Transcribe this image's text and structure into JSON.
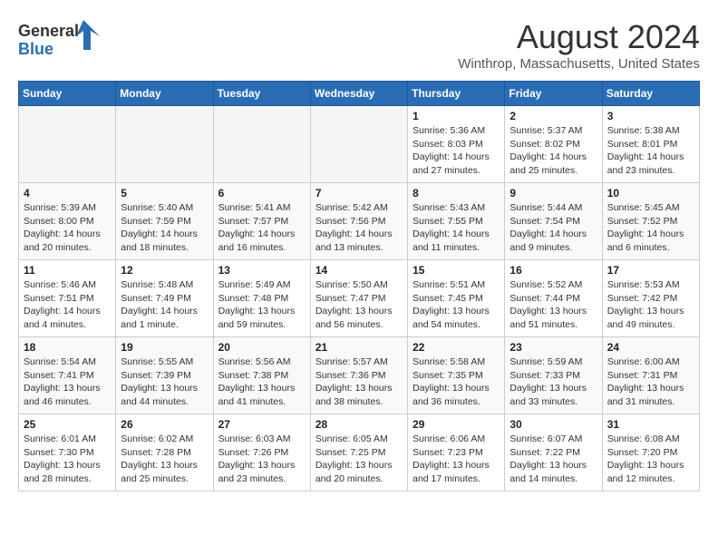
{
  "header": {
    "logo_line1": "General",
    "logo_line2": "Blue",
    "month_year": "August 2024",
    "location": "Winthrop, Massachusetts, United States"
  },
  "weekdays": [
    "Sunday",
    "Monday",
    "Tuesday",
    "Wednesday",
    "Thursday",
    "Friday",
    "Saturday"
  ],
  "weeks": [
    [
      {
        "day": "",
        "info": ""
      },
      {
        "day": "",
        "info": ""
      },
      {
        "day": "",
        "info": ""
      },
      {
        "day": "",
        "info": ""
      },
      {
        "day": "1",
        "info": "Sunrise: 5:36 AM\nSunset: 8:03 PM\nDaylight: 14 hours\nand 27 minutes."
      },
      {
        "day": "2",
        "info": "Sunrise: 5:37 AM\nSunset: 8:02 PM\nDaylight: 14 hours\nand 25 minutes."
      },
      {
        "day": "3",
        "info": "Sunrise: 5:38 AM\nSunset: 8:01 PM\nDaylight: 14 hours\nand 23 minutes."
      }
    ],
    [
      {
        "day": "4",
        "info": "Sunrise: 5:39 AM\nSunset: 8:00 PM\nDaylight: 14 hours\nand 20 minutes."
      },
      {
        "day": "5",
        "info": "Sunrise: 5:40 AM\nSunset: 7:59 PM\nDaylight: 14 hours\nand 18 minutes."
      },
      {
        "day": "6",
        "info": "Sunrise: 5:41 AM\nSunset: 7:57 PM\nDaylight: 14 hours\nand 16 minutes."
      },
      {
        "day": "7",
        "info": "Sunrise: 5:42 AM\nSunset: 7:56 PM\nDaylight: 14 hours\nand 13 minutes."
      },
      {
        "day": "8",
        "info": "Sunrise: 5:43 AM\nSunset: 7:55 PM\nDaylight: 14 hours\nand 11 minutes."
      },
      {
        "day": "9",
        "info": "Sunrise: 5:44 AM\nSunset: 7:54 PM\nDaylight: 14 hours\nand 9 minutes."
      },
      {
        "day": "10",
        "info": "Sunrise: 5:45 AM\nSunset: 7:52 PM\nDaylight: 14 hours\nand 6 minutes."
      }
    ],
    [
      {
        "day": "11",
        "info": "Sunrise: 5:46 AM\nSunset: 7:51 PM\nDaylight: 14 hours\nand 4 minutes."
      },
      {
        "day": "12",
        "info": "Sunrise: 5:48 AM\nSunset: 7:49 PM\nDaylight: 14 hours\nand 1 minute."
      },
      {
        "day": "13",
        "info": "Sunrise: 5:49 AM\nSunset: 7:48 PM\nDaylight: 13 hours\nand 59 minutes."
      },
      {
        "day": "14",
        "info": "Sunrise: 5:50 AM\nSunset: 7:47 PM\nDaylight: 13 hours\nand 56 minutes."
      },
      {
        "day": "15",
        "info": "Sunrise: 5:51 AM\nSunset: 7:45 PM\nDaylight: 13 hours\nand 54 minutes."
      },
      {
        "day": "16",
        "info": "Sunrise: 5:52 AM\nSunset: 7:44 PM\nDaylight: 13 hours\nand 51 minutes."
      },
      {
        "day": "17",
        "info": "Sunrise: 5:53 AM\nSunset: 7:42 PM\nDaylight: 13 hours\nand 49 minutes."
      }
    ],
    [
      {
        "day": "18",
        "info": "Sunrise: 5:54 AM\nSunset: 7:41 PM\nDaylight: 13 hours\nand 46 minutes."
      },
      {
        "day": "19",
        "info": "Sunrise: 5:55 AM\nSunset: 7:39 PM\nDaylight: 13 hours\nand 44 minutes."
      },
      {
        "day": "20",
        "info": "Sunrise: 5:56 AM\nSunset: 7:38 PM\nDaylight: 13 hours\nand 41 minutes."
      },
      {
        "day": "21",
        "info": "Sunrise: 5:57 AM\nSunset: 7:36 PM\nDaylight: 13 hours\nand 38 minutes."
      },
      {
        "day": "22",
        "info": "Sunrise: 5:58 AM\nSunset: 7:35 PM\nDaylight: 13 hours\nand 36 minutes."
      },
      {
        "day": "23",
        "info": "Sunrise: 5:59 AM\nSunset: 7:33 PM\nDaylight: 13 hours\nand 33 minutes."
      },
      {
        "day": "24",
        "info": "Sunrise: 6:00 AM\nSunset: 7:31 PM\nDaylight: 13 hours\nand 31 minutes."
      }
    ],
    [
      {
        "day": "25",
        "info": "Sunrise: 6:01 AM\nSunset: 7:30 PM\nDaylight: 13 hours\nand 28 minutes."
      },
      {
        "day": "26",
        "info": "Sunrise: 6:02 AM\nSunset: 7:28 PM\nDaylight: 13 hours\nand 25 minutes."
      },
      {
        "day": "27",
        "info": "Sunrise: 6:03 AM\nSunset: 7:26 PM\nDaylight: 13 hours\nand 23 minutes."
      },
      {
        "day": "28",
        "info": "Sunrise: 6:05 AM\nSunset: 7:25 PM\nDaylight: 13 hours\nand 20 minutes."
      },
      {
        "day": "29",
        "info": "Sunrise: 6:06 AM\nSunset: 7:23 PM\nDaylight: 13 hours\nand 17 minutes."
      },
      {
        "day": "30",
        "info": "Sunrise: 6:07 AM\nSunset: 7:22 PM\nDaylight: 13 hours\nand 14 minutes."
      },
      {
        "day": "31",
        "info": "Sunrise: 6:08 AM\nSunset: 7:20 PM\nDaylight: 13 hours\nand 12 minutes."
      }
    ]
  ]
}
